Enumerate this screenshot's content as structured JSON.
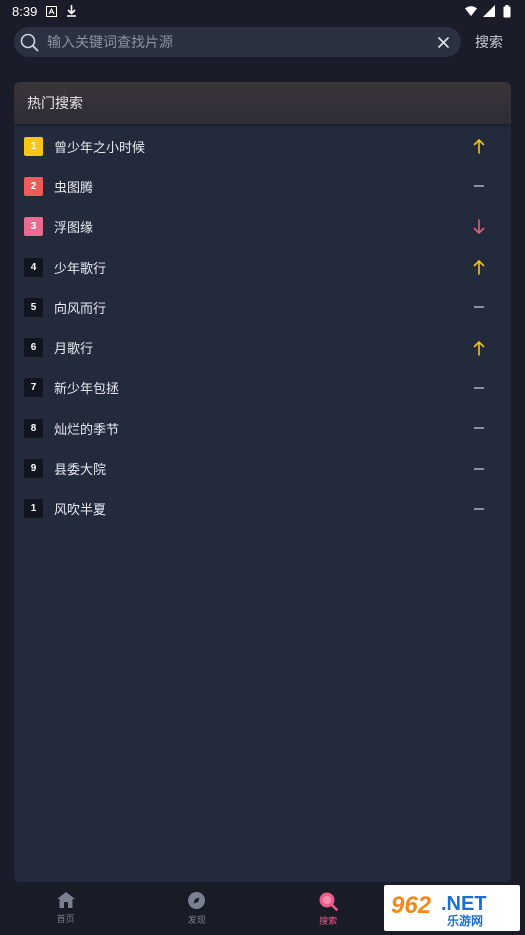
{
  "status_bar": {
    "time": "8:39"
  },
  "search": {
    "placeholder": "输入关键词查找片源",
    "submit_label": "搜索"
  },
  "hot_search": {
    "title": "热门搜索",
    "items": [
      {
        "rank": "1",
        "title": "曾少年之小时候",
        "trend": "up"
      },
      {
        "rank": "2",
        "title": "虫图腾",
        "trend": "flat"
      },
      {
        "rank": "3",
        "title": "浮图缘",
        "trend": "down"
      },
      {
        "rank": "4",
        "title": "少年歌行",
        "trend": "up"
      },
      {
        "rank": "5",
        "title": "向风而行",
        "trend": "flat"
      },
      {
        "rank": "6",
        "title": "月歌行",
        "trend": "up"
      },
      {
        "rank": "7",
        "title": "新少年包拯",
        "trend": "flat"
      },
      {
        "rank": "8",
        "title": "灿烂的季节",
        "trend": "flat"
      },
      {
        "rank": "9",
        "title": "县委大院",
        "trend": "flat"
      },
      {
        "rank": "1",
        "title": "风吹半夏",
        "trend": "flat"
      }
    ]
  },
  "bottom_nav": {
    "items": [
      {
        "label": "首页",
        "icon": "home-icon",
        "active": false
      },
      {
        "label": "发现",
        "icon": "compass-icon",
        "active": false
      },
      {
        "label": "搜索",
        "icon": "search-icon",
        "active": true
      }
    ]
  },
  "watermark": {
    "text": "962.NET 乐游网"
  },
  "colors": {
    "rank1": "#f5c518",
    "rank2": "#ef5a5a",
    "rank3": "#e96b8f",
    "trend_up": "#f5c518",
    "trend_down": "#e0607e",
    "trend_flat": "#b8bcc8",
    "accent": "#ee5b8c"
  }
}
